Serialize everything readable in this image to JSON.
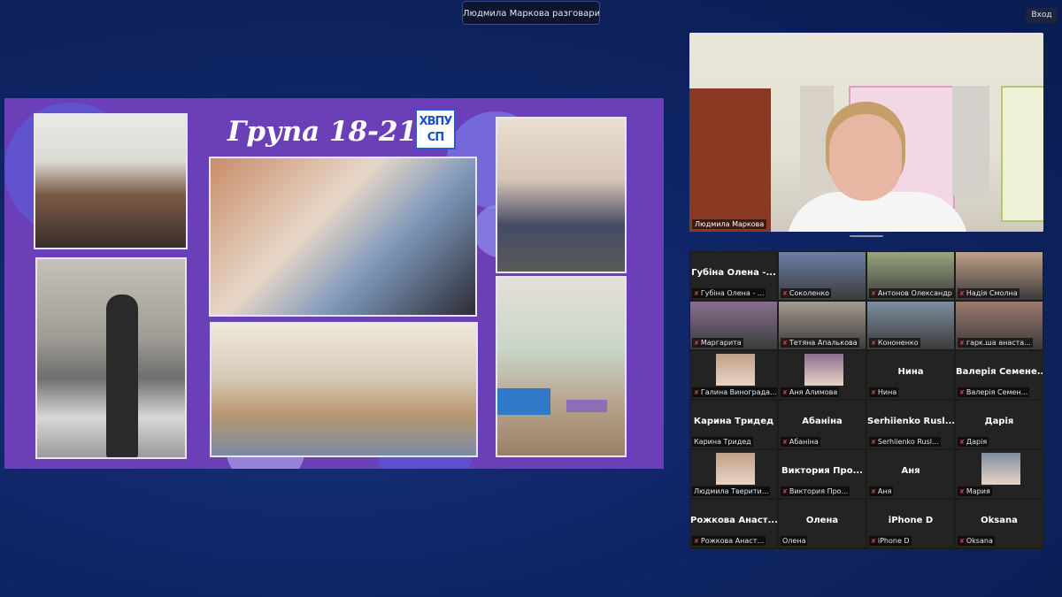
{
  "top": {
    "speaking_notice": "Людмила Маркова разговаривает...",
    "view_button": "Вход"
  },
  "slide": {
    "title": "Група  18-21",
    "logo_top": "ХВПУ",
    "logo_bottom": "СП"
  },
  "speaker": {
    "name": "Людмила Маркова"
  },
  "participants": [
    {
      "big": "Губіна Олена -...",
      "label": "Губіна Олена - ...",
      "muted": true,
      "video": false
    },
    {
      "big": "",
      "label": "Соколенко",
      "muted": true,
      "video": true
    },
    {
      "big": "",
      "label": "Антонов Олександр",
      "muted": true,
      "video": true
    },
    {
      "big": "",
      "label": "Надія Смолна",
      "muted": true,
      "video": true
    },
    {
      "big": "",
      "label": "Маргарита",
      "muted": true,
      "video": true
    },
    {
      "big": "",
      "label": "Тетяна Апалькова",
      "muted": true,
      "video": true
    },
    {
      "big": "",
      "label": "Кононенко",
      "muted": true,
      "video": true
    },
    {
      "big": "",
      "label": "гарк.ша анаста...",
      "muted": true,
      "video": true
    },
    {
      "big": "",
      "label": "Галина Винограда...",
      "muted": true,
      "video": false,
      "thumb": true
    },
    {
      "big": "",
      "label": "Аня Алимова",
      "muted": true,
      "video": false,
      "thumb": true
    },
    {
      "big": "Нина",
      "label": "Нина",
      "muted": true,
      "video": false
    },
    {
      "big": "Валерія Семене...",
      "label": "Валерія Семен...",
      "muted": true,
      "video": false
    },
    {
      "big": "Карина Тридед",
      "label": "Карина Тридед",
      "muted": false,
      "video": false
    },
    {
      "big": "Абаніна",
      "label": "Абаніна",
      "muted": true,
      "video": false
    },
    {
      "big": "Serhiienko  Rusl...",
      "label": "Serhiienko Rusl...",
      "muted": true,
      "video": false
    },
    {
      "big": "Дарія",
      "label": "Дарія",
      "muted": true,
      "video": false
    },
    {
      "big": "",
      "label": "Людмила Тверити...",
      "muted": false,
      "video": false,
      "thumb": true
    },
    {
      "big": "Виктория  Про...",
      "label": "Виктория Про...",
      "muted": true,
      "video": false
    },
    {
      "big": "Аня",
      "label": "Аня",
      "muted": true,
      "video": false
    },
    {
      "big": "",
      "label": "Мария",
      "muted": true,
      "video": false,
      "thumb": true
    },
    {
      "big": "Рожкова  Анаст...",
      "label": "Рожкова Анаст...",
      "muted": true,
      "video": false
    },
    {
      "big": "Олена",
      "label": "Олена",
      "muted": false,
      "video": false
    },
    {
      "big": "iPhone D",
      "label": "iPhone D",
      "muted": true,
      "video": false
    },
    {
      "big": "Oksana",
      "label": "Oksana",
      "muted": true,
      "video": false
    }
  ],
  "colors": {
    "slide_bg": "#6a3fb8",
    "muted_icon": "#e5363b",
    "gallery_bg": "#1c1c1c"
  }
}
